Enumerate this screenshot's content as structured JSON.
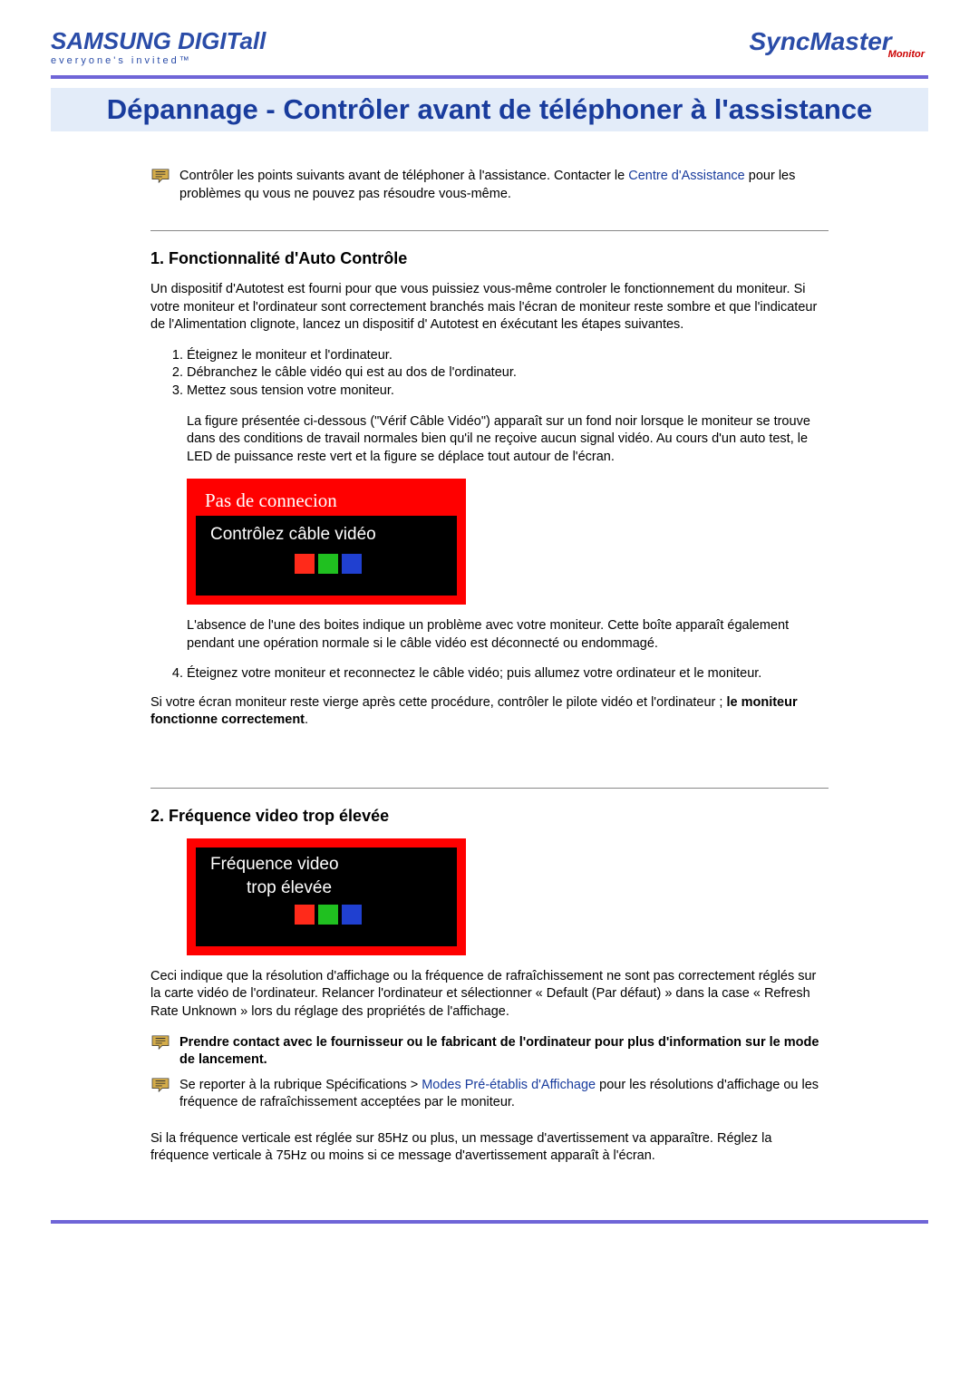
{
  "header": {
    "left_logo_main": "SAMSUNG DIGITall",
    "left_logo_tag": "everyone's invited™",
    "right_logo_main": "SyncMaster",
    "right_logo_sub": "Monitor"
  },
  "title": "Dépannage -  Contrôler avant de téléphoner à l'assistance",
  "intro": {
    "before_link": "Contrôler les points suivants avant de téléphoner à l'assistance. Contacter le ",
    "link": "Centre d'Assistance",
    "after_link": " pour les problèmes qu vous ne pouvez pas résoudre vous-même."
  },
  "section1": {
    "heading": "1. Fonctionnalité d'Auto Contrôle",
    "para1": "Un dispositif d'Autotest est fourni pour que vous puissiez vous-même controler le fonctionnement du moniteur. Si votre moniteur et l'ordinateur sont correctement branchés mais l'écran de moniteur reste sombre et que l'indicateur de l'Alimentation clignote, lancez un dispositif d' Autotest en éxécutant les étapes suivantes.",
    "steps123": [
      "Éteignez le moniteur et l'ordinateur.",
      "Débranchez le câble vidéo qui est au dos de l'ordinateur.",
      "Mettez sous tension votre moniteur."
    ],
    "indent_para": "La figure présentée ci-dessous (\"Vérif Câble Vidéo\") apparaît sur un fond noir lorsque le moniteur se trouve dans des conditions de travail normales bien qu'il ne reçoive aucun signal vidéo. Au cours d'un auto test, le LED de puissance reste vert et la figure se déplace tout autour de l'écran.",
    "warning_box": {
      "strip": "Pas de connecion",
      "line": "Contrôlez câble vidéo"
    },
    "indent_para2": "L'absence de l'une des boites indique un problème avec votre moniteur. Cette boîte apparaît également pendant une opération normale si le câble vidéo est déconnecté ou endommagé.",
    "step4": "Éteignez votre moniteur et reconnectez le câble vidéo; puis allumez votre ordinateur et le moniteur.",
    "closing_before_bold": "Si votre écran moniteur reste vierge après cette procédure, contrôler le pilote vidéo et l'ordinateur ; ",
    "closing_bold": "le moniteur fonctionne correctement",
    "closing_after_bold": "."
  },
  "section2": {
    "heading": "2. Fréquence video trop élevée",
    "warning_box": {
      "line1": "Fréquence video",
      "line2": "trop élevée"
    },
    "para1": "Ceci indique que la résolution d'affichage ou la fréquence de rafraîchissement ne sont pas correctement réglés sur la carte vidéo de l'ordinateur. Relancer l'ordinateur et sélectionner « Default (Par défaut) » dans la case « Refresh Rate Unknown » lors du réglage des propriétés de l'affichage.",
    "tip1_bold": "Prendre contact avec le fournisseur ou le fabricant de l'ordinateur pour plus d'information sur le mode de lancement.",
    "tip2_before": "Se reporter à la rubrique Spécifications > ",
    "tip2_link": "Modes Pré-établis d'Affichage",
    "tip2_after": " pour les résolutions d'affichage ou les fréquence de rafraîchissement acceptées par le moniteur.",
    "para2": "Si la fréquence verticale est réglée sur 85Hz ou plus, un message d'avertissement va apparaître. Réglez la fréquence verticale à 75Hz ou moins si ce message d'avertissement apparaît à l'écran."
  }
}
